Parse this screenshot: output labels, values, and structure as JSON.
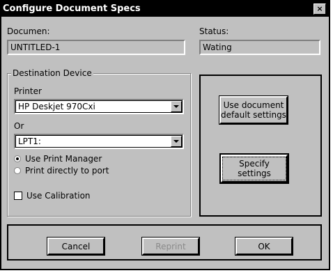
{
  "window": {
    "title": "Configure Document Specs",
    "close_glyph": "×"
  },
  "document": {
    "label": "Documen:",
    "value": "UNTITLED-1"
  },
  "status": {
    "label": "Status:",
    "value": "Wating"
  },
  "destination": {
    "group_title": "Destination Device",
    "printer_label": "Printer",
    "printer_value": "HP Deskjet 970Cxi",
    "or_label": "Or",
    "port_value": "LPT1:",
    "radio_print_manager": "Use Print Manager",
    "radio_print_direct": "Print directly to port",
    "calibration_label": "Use Calibration"
  },
  "settings": {
    "use_default_label": "Use document default settings",
    "specify_label": "Specify settings"
  },
  "footer": {
    "cancel_label": "Cancel",
    "reprint_label": "Reprint",
    "ok_label": "OK"
  },
  "states": {
    "use_print_manager_selected": true,
    "print_directly_selected": false,
    "use_calibration_checked": false,
    "reprint_enabled": false
  }
}
